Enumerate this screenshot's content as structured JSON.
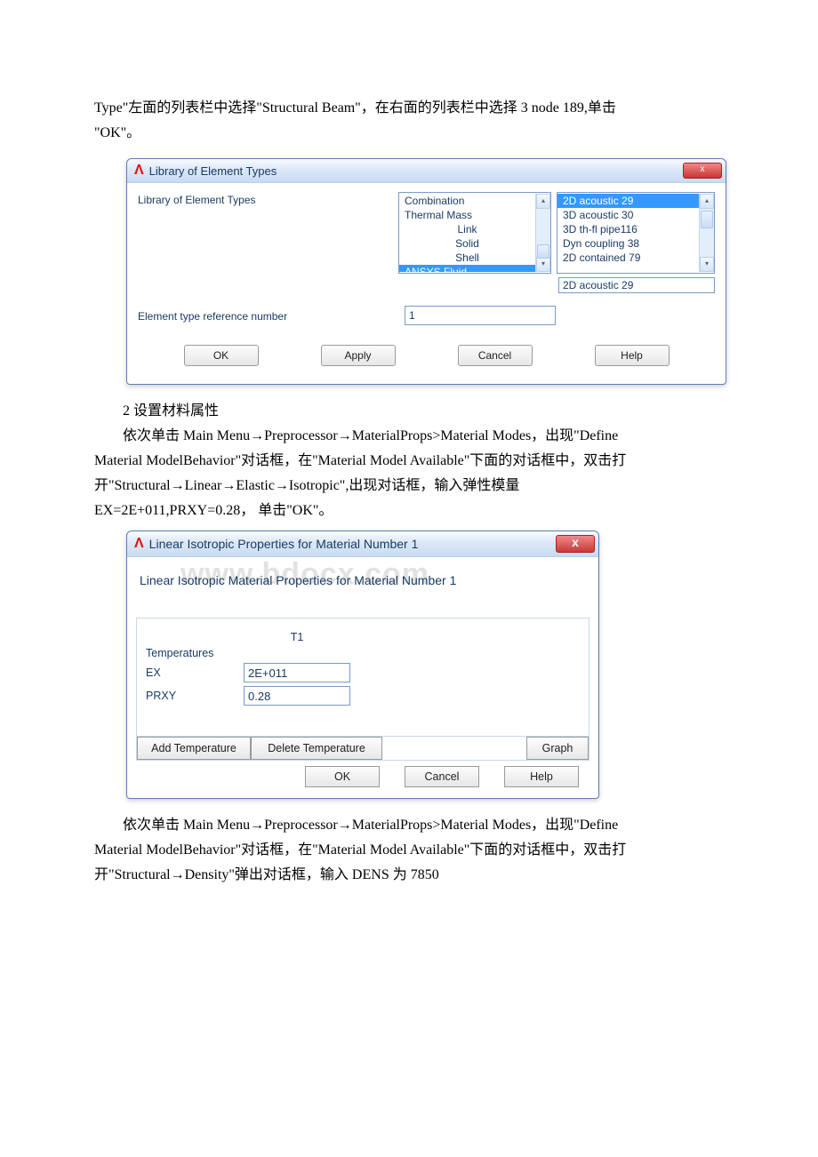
{
  "text": {
    "intro_l1": "Type\"左面的列表栏中选择\"Structural Beam\"，在右面的列表栏中选择 3 node 189,单击",
    "intro_l2": "\"OK\"。",
    "sec2_heading": "2 设置材料属性",
    "p2_l1": "依次单击 Main Menu→Preprocessor→MaterialProps>Material Modes，出现\"Define",
    "p2_l2": "Material ModelBehavior\"对话框，在\"Material Model Available\"下面的对话框中，双击打",
    "p2_l3": "开\"Structural→Linear→Elastic→Isotropic\",出现对话框，输入弹性模量",
    "p2_l4": "EX=2E+011,PRXY=0.28， 单击\"OK\"。",
    "p3_l1": "依次单击 Main Menu→Preprocessor→MaterialProps>Material Modes，出现\"Define",
    "p3_l2": "Material ModelBehavior\"对话框，在\"Material Model Available\"下面的对话框中，双击打",
    "p3_l3": "开\"Structural→Density\"弹出对话框，输入 DENS 为 7850"
  },
  "dlg1": {
    "title": "Library of Element Types",
    "library_label": "Library of Element Types",
    "left_list": [
      "Combination",
      "Thermal Mass",
      "Link",
      "Solid",
      "Shell",
      "ANSYS Fluid"
    ],
    "right_list": [
      "2D acoustic   29",
      "3D acoustic   30",
      "3D th-fl pipe116",
      "Dyn coupling  38",
      "2D contained  79"
    ],
    "selected_readout": "2D acoustic   29",
    "refnum_label": "Element type reference number",
    "refnum_value": "1",
    "buttons": {
      "ok": "OK",
      "apply": "Apply",
      "cancel": "Cancel",
      "help": "Help"
    }
  },
  "dlg2": {
    "title": "Linear Isotropic Properties for Material Number 1",
    "watermark": "www.bdocx.com",
    "subheader": "Linear Isotropic Material Properties for Material Number 1",
    "col_t1": "T1",
    "rows": {
      "temperatures": "Temperatures",
      "ex": "EX",
      "prxy": "PRXY"
    },
    "values": {
      "ex": "2E+011",
      "prxy": "0.28"
    },
    "buttons": {
      "add_temp": "Add Temperature",
      "del_temp": "Delete Temperature",
      "graph": "Graph",
      "ok": "OK",
      "cancel": "Cancel",
      "help": "Help"
    }
  }
}
